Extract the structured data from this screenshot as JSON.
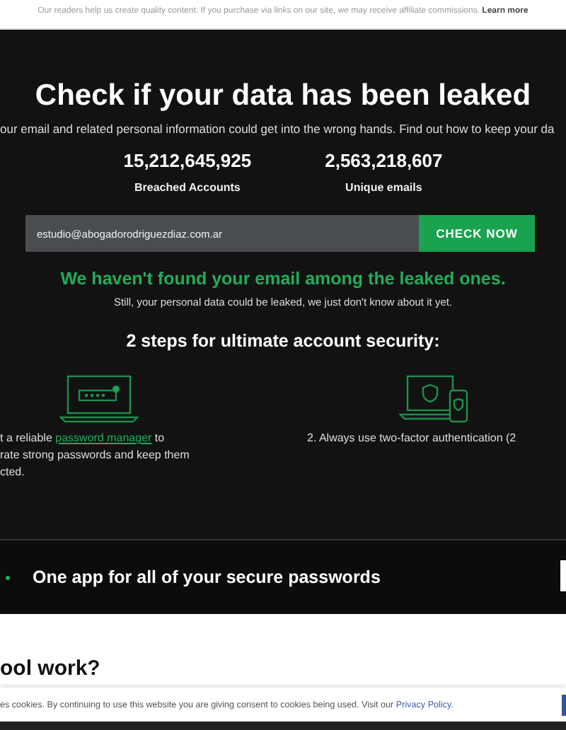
{
  "notice": {
    "text": "Our readers help us create quality content. If you purchase via links on our site, we may receive affiliate commissions.",
    "link": "Learn more"
  },
  "hero": {
    "title": "Check if your data has been leaked",
    "subtitle": "our email and related personal information could get into the wrong hands. Find out how to keep your da"
  },
  "stats": [
    {
      "value": "15,212,645,925",
      "label": "Breached Accounts"
    },
    {
      "value": "2,563,218,607",
      "label": "Unique emails"
    }
  ],
  "search": {
    "value": "estudio@abogadorodriguezdiaz.com.ar",
    "button": "CHECK NOW"
  },
  "result": {
    "headline": "We haven't found your email among the leaked ones.",
    "note": "Still, your personal data could be leaked, we just don't know about it yet."
  },
  "steps_title": "2 steps for ultimate account security:",
  "steps": [
    {
      "kind": "password",
      "before": "t a reliable ",
      "link": "password manager",
      "after": " to",
      "rest": [
        "rate strong passwords and keep them",
        "cted."
      ]
    },
    {
      "kind": "twofactor",
      "before": "2. Always use two-factor authentication (2"
    }
  ],
  "banner": {
    "text": "One app for all of your secure passwords"
  },
  "section_heading": "ool work?",
  "cookie": {
    "text": "es cookies. By continuing to use this website you are giving consent to cookies being used. Visit our",
    "link": "Privacy Policy."
  }
}
